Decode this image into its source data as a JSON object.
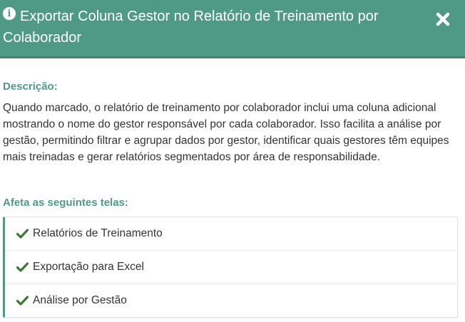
{
  "modal": {
    "title": "Exportar Coluna Gestor no Relatório de Treinamento por Colaborador",
    "info_icon": "info-circle-icon",
    "close_icon": "close-icon",
    "accent_color": "#4f9a87"
  },
  "description": {
    "label": "Descrição:",
    "text": "Quando marcado, o relatório de treinamento por colaborador inclui uma coluna adicional mostrando o nome do gestor responsável por cada colaborador. Isso facilita a análise por gestão, permitindo filtrar e agrupar dados por gestor, identificar quais gestores têm equipes mais treinadas e gerar relatórios segmentados por área de responsabilidade."
  },
  "affected": {
    "label": "Afeta as seguintes telas:",
    "items": [
      {
        "label": "Relatórios de Treinamento",
        "icon": "check-icon"
      },
      {
        "label": "Exportação para Excel",
        "icon": "check-icon"
      },
      {
        "label": "Análise por Gestão",
        "icon": "check-icon"
      }
    ]
  }
}
